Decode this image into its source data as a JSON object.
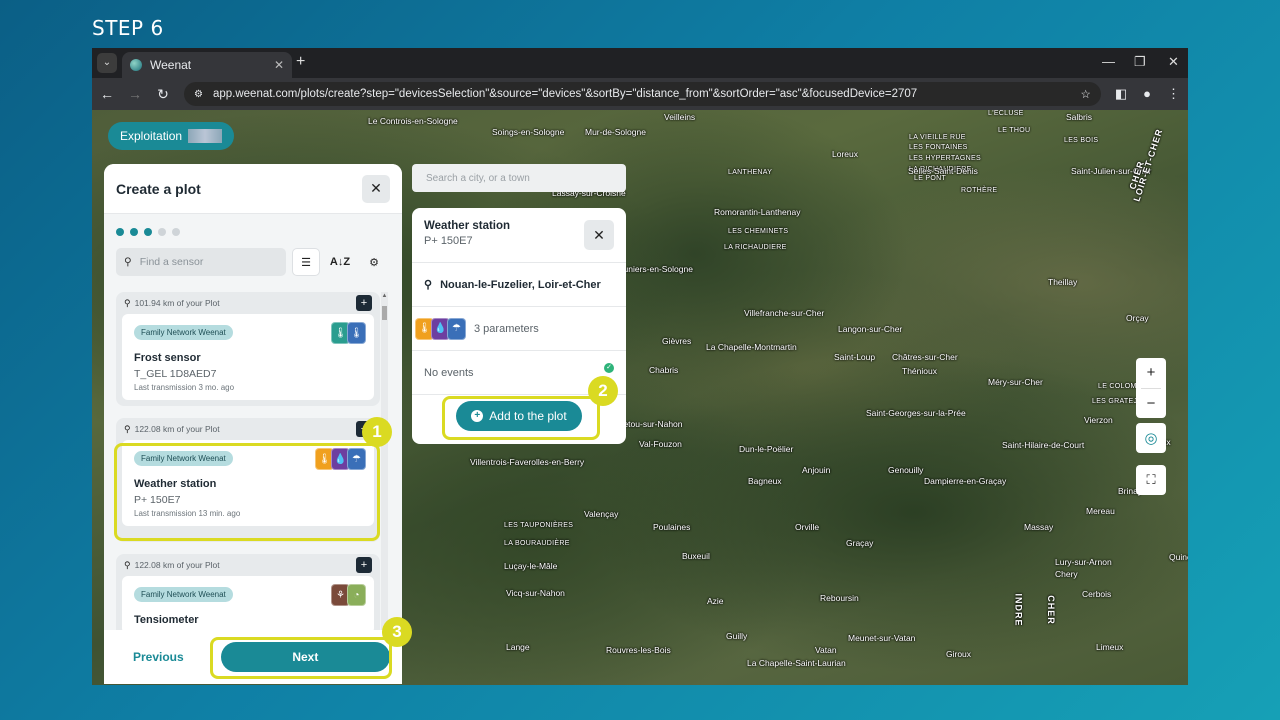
{
  "step_title": "STEP 6",
  "browser": {
    "tab_title": "Weenat",
    "url": "app.weenat.com/plots/create?step=\"devicesSelection\"&source=\"devices\"&sortBy=\"distance_from\"&sortOrder=\"asc\"&focusedDevice=2707"
  },
  "map": {
    "exploitation_label": "Exploitation",
    "search_placeholder": "Search a city, or a town",
    "places": [
      "Le Controis-en-Sologne",
      "Veilleins",
      "Soings-en-Sologne",
      "Mur-de-Sologne",
      "L'ECLUSE",
      "Salbris",
      "LA VIEILLE RUE",
      "LES FONTAINES",
      "LE THOU",
      "LES HYPERTAGNES",
      "LA RICHAUDIERE",
      "LES BOIS",
      "LANTHENAY",
      "Loreux",
      "Selles-Saint-Denis",
      "LE PONT",
      "ROTHÈRE",
      "Saint-Julien-sur-Cher",
      "Lassay-sur-Croisne",
      "Romorantin-Lanthenay",
      "LES CHEMINETS",
      "LA RICHAUDIERE",
      "Pruniers-en-Sologne",
      "Theillay",
      "Villefranche-sur-Cher",
      "Langon-sur-Cher",
      "Orçay",
      "Gièvres",
      "La Chapelle-Montmartin",
      "Chabris",
      "Saint-Loup",
      "Châtres-sur-Cher",
      "Thénioux",
      "Méry-sur-Cher",
      "LE COLOMBIER",
      "LES GRATEJOTS",
      "nnetou-sur-Nahon",
      "Saint-Georges-sur-la-Prée",
      "Vierzon",
      "Val-Fouzon",
      "Dun-le-Poëlier",
      "Saint-Hilaire-de-Court",
      "Villentrois-Faverolles-en-Berry",
      "Anjouin",
      "Genouilly",
      "Bagneux",
      "Dampierre-en-Graçay",
      "Brinay",
      "Valençay",
      "LES TAUPONIÈRES",
      "Poulaines",
      "Orville",
      "Mereau",
      "Massay",
      "LA BOURAUDIÈRE",
      "Luçay-le-Mâle",
      "Graçay",
      "Buxeuil",
      "Lury-sur-Arnon",
      "Chery",
      "Vicq-sur-Nahon",
      "Reboursin",
      "Cerbois",
      "Azie",
      "Lange",
      "Guilly",
      "Meunet-sur-Vatan",
      "Limeux",
      "Rouvres-les-Bois",
      "Vatan",
      "Giroux",
      "La Chapelle-Saint-Laurian",
      "Vignoux",
      "Quincy"
    ],
    "rivers": [
      "LOIR-ET-CHER",
      "CHER",
      "INDRE",
      "CHER"
    ]
  },
  "panel": {
    "title": "Create a plot",
    "search_placeholder": "Find a sensor",
    "steps_total": 5,
    "steps_done": 3,
    "previous_label": "Previous",
    "next_label": "Next",
    "devices": [
      {
        "distance": "101.94 km of your Plot",
        "badge": "Family Network Weenat",
        "name": "Frost sensor",
        "serial": "T_GEL 1D8AED7",
        "last": "Last transmission 3 mo. ago"
      },
      {
        "distance": "122.08 km of your Plot",
        "badge": "Family Network Weenat",
        "name": "Weather station",
        "serial": "P+ 150E7",
        "last": "Last transmission 13 min. ago"
      },
      {
        "distance": "122.08 km of your Plot",
        "badge": "Family Network Weenat",
        "name": "Tensiometer",
        "serial": "",
        "last": ""
      }
    ]
  },
  "popup": {
    "title": "Weather station",
    "serial": "P+ 150E7",
    "location": "Nouan-le-Fuzelier, Loir-et-Cher",
    "parameters": "3 parameters",
    "events": "No events",
    "add_label": "Add to the plot"
  },
  "callouts": [
    "1",
    "2",
    "3"
  ],
  "colors": {
    "accent": "#1a8a96",
    "highlight": "#dada22",
    "temp": "#f0a01e",
    "rain": "#6d3fa0",
    "wind": "#3a6fb8",
    "frost_a": "#2a9d8f",
    "frost_b": "#3a6fb8",
    "tensio": "#7a4a3a",
    "tensio_b": "#8aae5a"
  }
}
